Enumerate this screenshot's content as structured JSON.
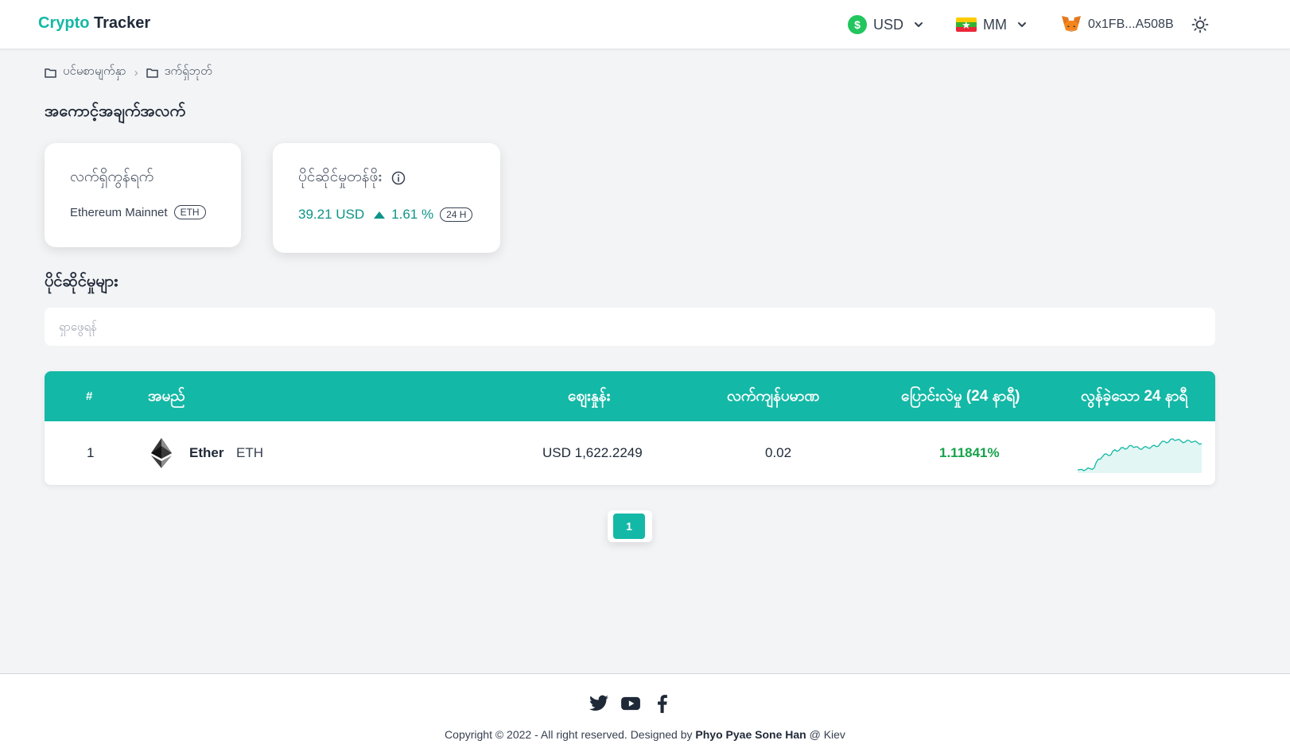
{
  "header": {
    "brand_part1": "Crypto",
    "brand_part2": "Tracker",
    "currency": "USD",
    "currency_icon": "$",
    "language": "MM",
    "wallet_address": "0x1FB...A508B"
  },
  "breadcrumb": {
    "items": [
      "ပင်မစာမျက်နှာ",
      "ဒက်ရှ်ဘုတ်"
    ]
  },
  "account_section": {
    "title": "အကောင့်အချက်အလက်"
  },
  "network_card": {
    "title": "လက်ရှိကွန်ရက်",
    "network_name": "Ethereum Mainnet",
    "network_badge": "ETH"
  },
  "portfolio_card": {
    "title": "ပိုင်ဆိုင်မှုတန်ဖိုး",
    "value": "39.21 USD",
    "change": "1.61 %",
    "period_badge": "24 H"
  },
  "assets_section": {
    "title": "ပိုင်ဆိုင်မှုများ",
    "search_placeholder": "ရှာဖွေရန်"
  },
  "table": {
    "headers": [
      "#",
      "အမည်",
      "စျေးနှုန်း",
      "လက်ကျန်ပမာဏ",
      "ပြောင်းလဲမှု (24 နာရီ)",
      "လွန်ခဲ့သော 24 နာရီ"
    ],
    "rows": [
      {
        "index": "1",
        "name": "Ether",
        "symbol": "ETH",
        "price": "USD 1,622.2249",
        "balance": "0.02",
        "change": "1.11841%"
      }
    ]
  },
  "sparkline": {
    "color": "#14b8a6",
    "values": [
      0.04,
      0.06,
      0.05,
      0.08,
      0.1,
      0.35,
      0.42,
      0.5,
      0.47,
      0.62,
      0.6,
      0.68,
      0.66,
      0.74,
      0.7,
      0.64,
      0.69,
      0.67,
      0.72,
      0.71,
      0.8,
      0.86,
      0.84,
      0.93,
      0.9,
      0.87,
      0.84,
      0.88,
      0.85,
      0.82,
      0.8
    ]
  },
  "pagination": {
    "current": "1"
  },
  "footer": {
    "copyright_prefix": "Copyright © 2022 - All right reserved. Designed by",
    "designer": "Phyo Pyae Sone Han",
    "location": "@ Kiev"
  },
  "colors": {
    "accent": "#14b8a6",
    "positive": "#16a34a"
  }
}
